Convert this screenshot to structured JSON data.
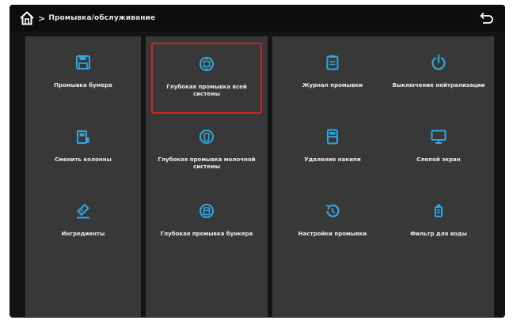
{
  "header": {
    "breadcrumb": "Промывка/обслуживание",
    "breadcrumb_sep": ">"
  },
  "colors": {
    "icon": "#2fa8e0",
    "selected_border": "#d02426",
    "panel": "#383838",
    "background": "#141414"
  },
  "tiles": [
    {
      "label": "Промывка бумера",
      "icon": "save-icon"
    },
    {
      "label": "Глубокая промывка всей системы",
      "icon": "deep-clean-system-icon",
      "selected": true
    },
    {
      "label": "Журнал промывки",
      "icon": "clipboard-log-icon"
    },
    {
      "label": "Выключение нейтрализации",
      "icon": "power-icon"
    },
    {
      "label": "Сменить колонны",
      "icon": "column-icon"
    },
    {
      "label": "Глубокая промывка молочной системы",
      "icon": "milk-system-icon"
    },
    {
      "label": "Удаление накипи",
      "icon": "descaling-icon"
    },
    {
      "label": "Слепой экран",
      "icon": "monitor-icon"
    },
    {
      "label": "Ингредиенты",
      "icon": "ingredients-icon"
    },
    {
      "label": "Глубокая промывка бункера",
      "icon": "hopper-icon"
    },
    {
      "label": "Настройки промывки",
      "icon": "history-settings-icon"
    },
    {
      "label": "Фильтр для воды",
      "icon": "water-filter-icon"
    }
  ]
}
